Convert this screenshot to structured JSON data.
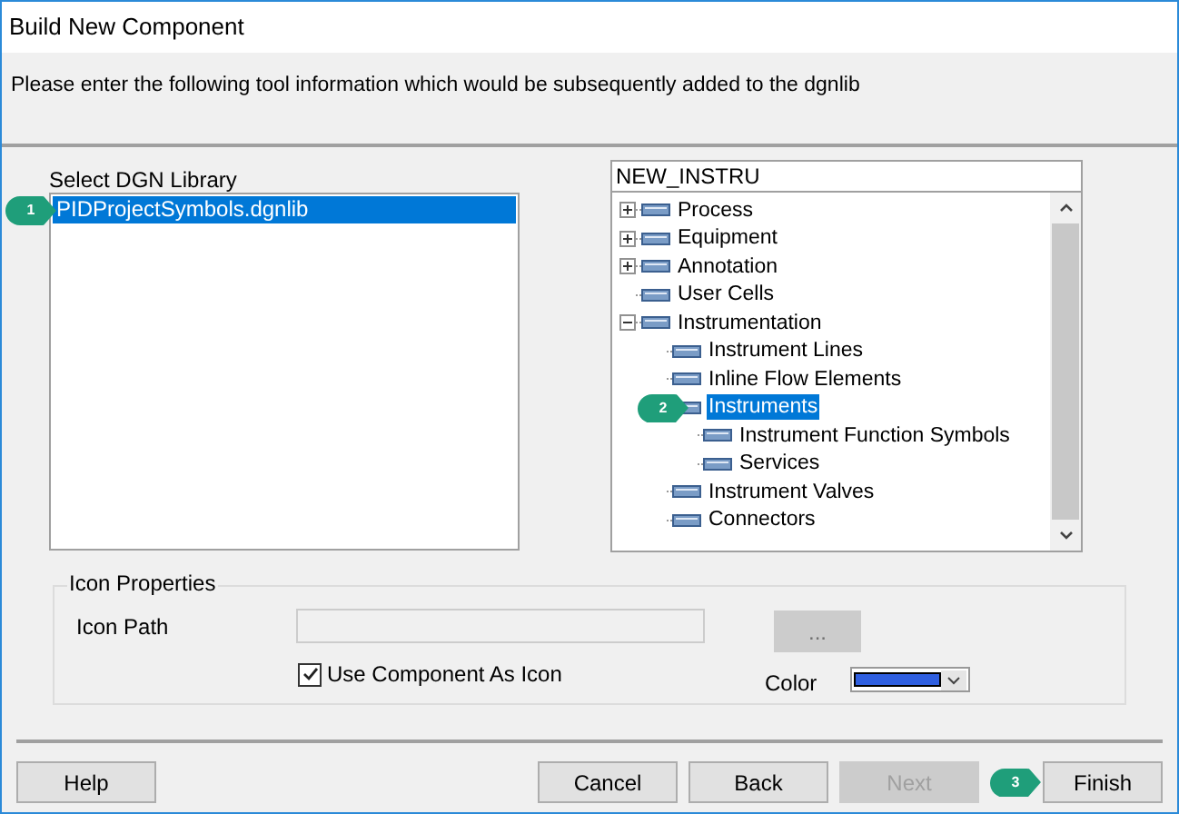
{
  "window": {
    "title": "Build New Component"
  },
  "instruction": "Please enter the following tool information which would be subsequently added to the dgnlib",
  "library": {
    "label": "Select DGN Library",
    "items": [
      {
        "text": "PIDProjectSymbols.dgnlib",
        "selected": true,
        "callout": "1"
      }
    ]
  },
  "tree": {
    "field_value": "NEW_INSTRU",
    "items": [
      {
        "text": "Process",
        "kind": "collapsed",
        "selected": false
      },
      {
        "text": "Equipment",
        "kind": "collapsed",
        "selected": false
      },
      {
        "text": "Annotation",
        "kind": "collapsed",
        "selected": false
      },
      {
        "text": "User Cells",
        "kind": "leaf",
        "selected": false
      },
      {
        "text": "Instrumentation",
        "kind": "expanded",
        "selected": false,
        "children": [
          {
            "text": "Instrument Lines",
            "kind": "leaf",
            "selected": false
          },
          {
            "text": "Inline Flow Elements",
            "kind": "leaf",
            "selected": false
          },
          {
            "text": "Instruments",
            "kind": "leaf",
            "selected": true,
            "callout": "2",
            "children": [
              {
                "text": "Instrument Function Symbols",
                "kind": "leaf",
                "selected": false
              },
              {
                "text": "Services",
                "kind": "leaf",
                "selected": false
              }
            ]
          },
          {
            "text": "Instrument Valves",
            "kind": "leaf",
            "selected": false
          },
          {
            "text": "Connectors",
            "kind": "leaf",
            "selected": false
          }
        ]
      }
    ]
  },
  "icon_properties": {
    "title": "Icon Properties",
    "icon_path_label": "Icon Path",
    "browse": {
      "text": "...",
      "disabled": true
    },
    "use_component": {
      "label": "Use Component As Icon",
      "checked": true
    },
    "color_label": "Color",
    "color": "#2f5fe0"
  },
  "buttons": [
    {
      "text": "Help",
      "disabled": false
    },
    {
      "text": "Cancel",
      "disabled": false
    },
    {
      "text": "Back",
      "disabled": false
    },
    {
      "text": "Next",
      "disabled": true
    },
    {
      "text": "Finish",
      "disabled": false,
      "callout": "3"
    }
  ]
}
